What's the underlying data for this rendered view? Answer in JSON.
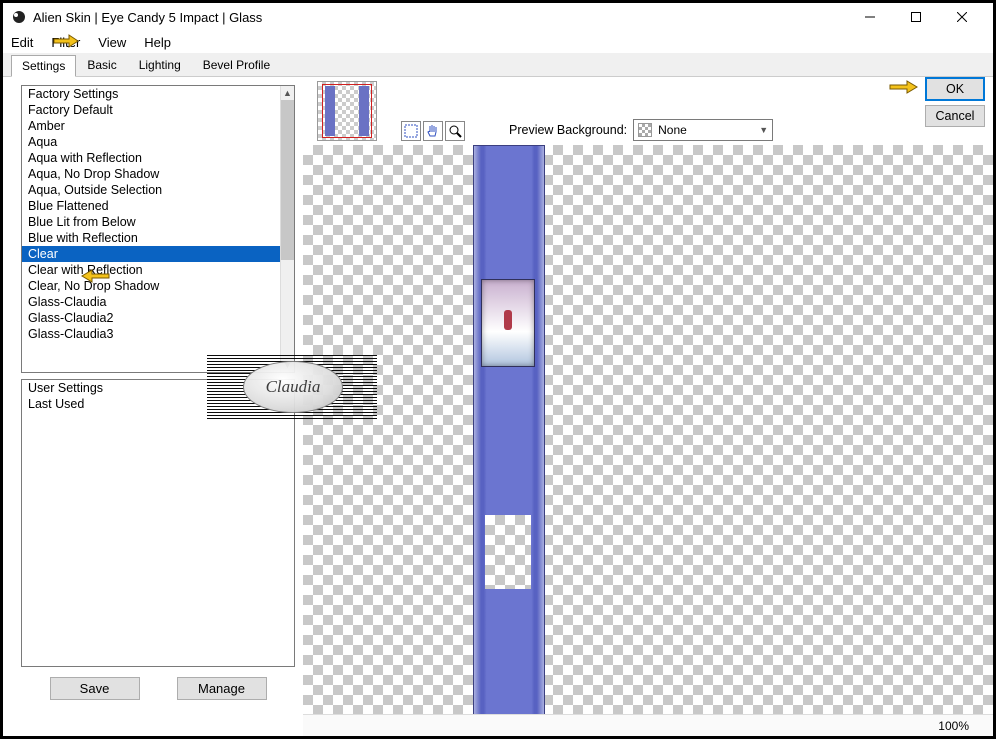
{
  "window": {
    "title": "Alien Skin | Eye Candy 5 Impact | Glass"
  },
  "menu": {
    "edit": "Edit",
    "filter": "Filter",
    "view": "View",
    "help": "Help"
  },
  "tabs": {
    "settings": "Settings",
    "basic": "Basic",
    "lighting": "Lighting",
    "bevel": "Bevel Profile"
  },
  "presets": {
    "items": [
      "Factory Settings",
      "Factory Default",
      "Amber",
      "Aqua",
      "Aqua with Reflection",
      "Aqua, No Drop Shadow",
      "Aqua, Outside Selection",
      "Blue Flattened",
      "Blue Lit from Below",
      "Blue with Reflection",
      "Clear",
      "Clear with Reflection",
      "Clear, No Drop Shadow",
      "Glass-Claudia",
      "Glass-Claudia2",
      "Glass-Claudia3"
    ],
    "selected_index": 10
  },
  "user_presets": {
    "items": [
      "User Settings",
      "Last Used"
    ]
  },
  "buttons": {
    "save": "Save",
    "manage": "Manage",
    "ok": "OK",
    "cancel": "Cancel"
  },
  "preview": {
    "label": "Preview Background:",
    "value": "None"
  },
  "status": {
    "zoom": "100%"
  },
  "watermark": {
    "text": "Claudia"
  }
}
